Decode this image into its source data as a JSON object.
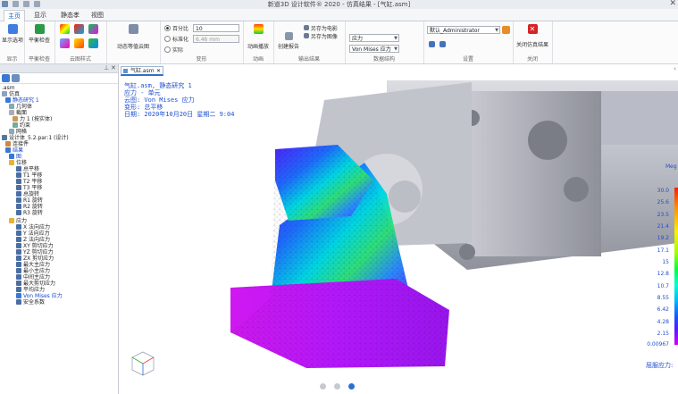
{
  "window": {
    "title": "新道3D 设计软件® 2020 - 仿真结果 - [气缸.asm]"
  },
  "tabs": [
    "主页",
    "显示",
    "静态孝",
    "视图"
  ],
  "ribbon": {
    "display_group": {
      "button": "显示选项",
      "label": "显示"
    },
    "check_group": {
      "button": "平衡检查",
      "label": "平衡检查"
    },
    "cloud_group": {
      "label": "云图样式"
    },
    "dynamic": {
      "button": "动态等值云图"
    },
    "deform": {
      "radio1": "百分比",
      "radio2": "标准化",
      "radio3": "实际",
      "value1": "10",
      "value2": "6.46 mm",
      "label": "变形"
    },
    "anim": {
      "button": "动画播放",
      "label": "动画"
    },
    "output": {
      "btn_report": "创建报告",
      "btn_movie": "另存为电影",
      "btn_image": "另存为图像",
      "label": "输出结果"
    },
    "data": {
      "select1": "应力",
      "select2": "Von Mises 应力",
      "label": "数据结构"
    },
    "settings": {
      "select": "默认_Administrator",
      "label": "设置"
    },
    "close": {
      "button": "关闭仿真结果",
      "label": "关闭"
    }
  },
  "left_panel": {
    "root": ".asm",
    "items": [
      "仿真",
      "静态研究 1",
      "几何体",
      "截面",
      "力 1 (按实体)",
      "约束",
      "网格",
      "设计体_5.2.par:1 (设计)",
      "连接件",
      "结果",
      "图",
      "位移",
      "总平移",
      "T1 平移",
      "T2 平移",
      "T3 平移",
      "总旋转",
      "R1 旋转",
      "R2 旋转",
      "R3 旋转",
      "应力",
      "X 法向应力",
      "Y 法向应力",
      "Z 法向应力",
      "XY 剪切应力",
      "YZ 剪切应力",
      "ZX 剪切应力",
      "最大主应力",
      "最小主应力",
      "中间主应力",
      "最大剪切应力",
      "平均应力",
      "Von Mises 应力",
      "安全系数"
    ]
  },
  "viewport": {
    "doc_tab": "气缸.asm",
    "annotations": [
      "气缸.asm, 静态研究 1",
      "应力 - 单元",
      "云图: Von Mises 应力",
      "变形: 总平移",
      "日期: 2020年10月20日 星期二  9:04"
    ],
    "legend_top": "Meg",
    "legend_ticks": [
      "30.0",
      "25.6",
      "23.5",
      "21.4",
      "19.2",
      "17.1",
      "15",
      "12.8",
      "10.7",
      "8.55",
      "6.42",
      "4.28",
      "2.15",
      "0.00967"
    ],
    "legend_title": "屈服应力:",
    "page_dots": 3,
    "active_dot": 2
  },
  "colors": {
    "accent": "#2b6fd6",
    "annotation_text": "#1f4fd0"
  }
}
